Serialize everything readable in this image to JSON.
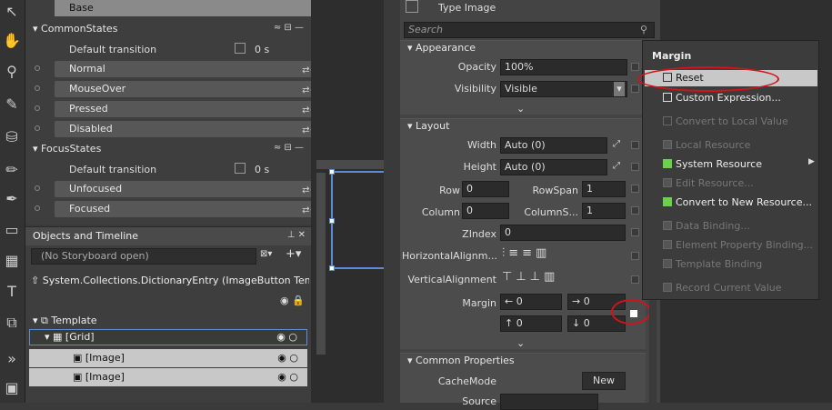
{
  "states": {
    "base_label": "Base",
    "groups": [
      {
        "name": "CommonStates",
        "default_transition": "Default transition",
        "duration": "0 s",
        "items": [
          "Normal",
          "MouseOver",
          "Pressed",
          "Disabled"
        ]
      },
      {
        "name": "FocusStates",
        "default_transition": "Default transition",
        "duration": "0 s",
        "items": [
          "Unfocused",
          "Focused"
        ]
      }
    ]
  },
  "objects": {
    "title": "Objects and Timeline",
    "storyboard": "(No Storyboard open)",
    "entry": "System.Collections.DictionaryEntry (ImageButton Temp...",
    "tree": [
      "Template",
      "[Grid]",
      "[Image]",
      "[Image]"
    ]
  },
  "props": {
    "type_label": "Type",
    "type_value": "Image",
    "search_placeholder": "Search",
    "appearance": {
      "title": "Appearance",
      "opacity_label": "Opacity",
      "opacity": "100%",
      "visibility_label": "Visibility",
      "visibility": "Visible"
    },
    "layout": {
      "title": "Layout",
      "width_label": "Width",
      "width": "Auto (0)",
      "height_label": "Height",
      "height": "Auto (0)",
      "row_label": "Row",
      "row": "0",
      "rowspan_label": "RowSpan",
      "rowspan": "1",
      "column_label": "Column",
      "column": "0",
      "columnspan_label": "ColumnS...",
      "columnspan": "1",
      "zindex_label": "ZIndex",
      "zindex": "0",
      "halign_label": "HorizontalAlignm...",
      "valign_label": "VerticalAlignment",
      "margin_label": "Margin",
      "margin": [
        "0",
        "0",
        "0",
        "0"
      ]
    },
    "common": {
      "title": "Common Properties",
      "cachemode_label": "CacheMode",
      "new_label": "New",
      "source_label": "Source"
    }
  },
  "menu": {
    "title": "Margin",
    "items": [
      {
        "label": "Reset",
        "enabled": true
      },
      {
        "label": "Custom Expression...",
        "enabled": true
      },
      {
        "label": "Convert to Local Value",
        "enabled": false
      },
      {
        "label": "Local Resource",
        "enabled": false
      },
      {
        "label": "System Resource",
        "enabled": true
      },
      {
        "label": "Edit Resource...",
        "enabled": false
      },
      {
        "label": "Convert to New Resource...",
        "enabled": true
      },
      {
        "label": "Data Binding...",
        "enabled": false
      },
      {
        "label": "Element Property Binding...",
        "enabled": false
      },
      {
        "label": "Template Binding",
        "enabled": false
      },
      {
        "label": "Record Current Value",
        "enabled": false
      }
    ]
  },
  "colors": {
    "highlight": "#d0141a",
    "green": "#6cd04a",
    "accent": "#5b8dd6"
  }
}
